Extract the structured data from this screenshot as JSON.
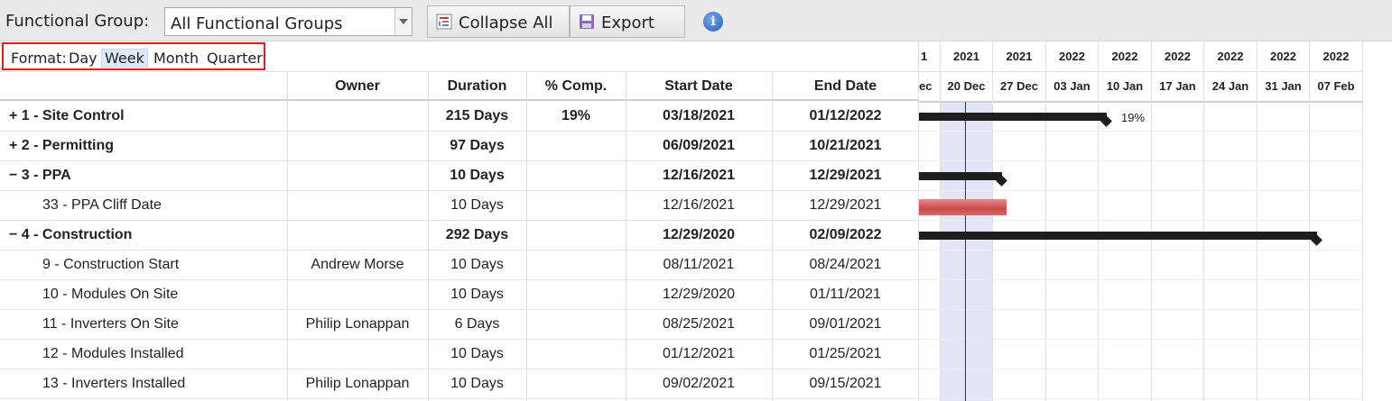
{
  "toolbar": {
    "functional_group_label": "Functional Group:",
    "functional_group_value": "All Functional Groups",
    "collapse_label": "Collapse All",
    "export_label": "Export"
  },
  "format": {
    "label": "Format:",
    "options": [
      "Day",
      "Week",
      "Month",
      "Quarter"
    ],
    "selected": "Week"
  },
  "columns": {
    "owner": "Owner",
    "duration": "Duration",
    "pct": "% Comp.",
    "start": "Start Date",
    "end": "End Date"
  },
  "rows": [
    {
      "name": "+ 1 - Site Control",
      "owner": "",
      "duration": "215 Days",
      "pct": "19%",
      "start": "03/18/2021",
      "end": "01/12/2022"
    },
    {
      "name": "+ 2 - Permitting",
      "owner": "",
      "duration": "97 Days",
      "pct": "",
      "start": "06/09/2021",
      "end": "10/21/2021"
    },
    {
      "name": "− 3 - PPA",
      "owner": "",
      "duration": "10 Days",
      "pct": "",
      "start": "12/16/2021",
      "end": "12/29/2021"
    },
    {
      "name": "33 - PPA Cliff Date",
      "owner": "",
      "duration": "10 Days",
      "pct": "",
      "start": "12/16/2021",
      "end": "12/29/2021"
    },
    {
      "name": "− 4 - Construction",
      "owner": "",
      "duration": "292 Days",
      "pct": "",
      "start": "12/29/2020",
      "end": "02/09/2022"
    },
    {
      "name": "9 - Construction Start",
      "owner": "Andrew Morse",
      "duration": "10 Days",
      "pct": "",
      "start": "08/11/2021",
      "end": "08/24/2021"
    },
    {
      "name": "10 - Modules On Site",
      "owner": "",
      "duration": "10 Days",
      "pct": "",
      "start": "12/29/2020",
      "end": "01/11/2021"
    },
    {
      "name": "11 - Inverters On Site",
      "owner": "Philip Lonappan",
      "duration": "6 Days",
      "pct": "",
      "start": "08/25/2021",
      "end": "09/01/2021"
    },
    {
      "name": "12 - Modules Installed",
      "owner": "",
      "duration": "10 Days",
      "pct": "",
      "start": "01/12/2021",
      "end": "01/25/2021"
    },
    {
      "name": "13 - Inverters Installed",
      "owner": "Philip Lonappan",
      "duration": "10 Days",
      "pct": "",
      "start": "09/02/2021",
      "end": "09/15/2021"
    }
  ],
  "gantt": {
    "years": [
      "1",
      "2021",
      "2021",
      "2022",
      "2022",
      "2022",
      "2022",
      "2022",
      "2022"
    ],
    "weeks": [
      "ec",
      "20 Dec",
      "27 Dec",
      "03 Jan",
      "10 Jan",
      "17 Jan",
      "24 Jan",
      "31 Jan",
      "07 Feb"
    ],
    "site_control_pct": "19%",
    "bar_color": "#1e1e1e",
    "milestone_color": "#d05a5a",
    "highlight_color": "#e4e4f7"
  }
}
